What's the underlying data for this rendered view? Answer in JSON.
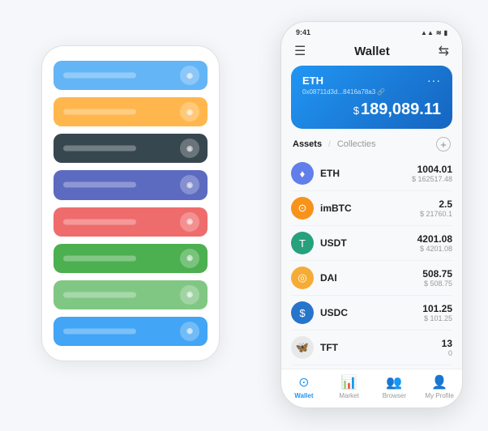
{
  "scene": {
    "bg_phone": {
      "cards": [
        {
          "color": "#64b5f6",
          "dot_label": ""
        },
        {
          "color": "#ffb74d",
          "dot_label": ""
        },
        {
          "color": "#37474f",
          "dot_label": ""
        },
        {
          "color": "#5c6bc0",
          "dot_label": ""
        },
        {
          "color": "#ef6c6c",
          "dot_label": ""
        },
        {
          "color": "#4caf50",
          "dot_label": ""
        },
        {
          "color": "#81c784",
          "dot_label": ""
        },
        {
          "color": "#42a5f5",
          "dot_label": ""
        }
      ]
    },
    "main_phone": {
      "status_bar": {
        "time": "9:41",
        "icons": "▲ ▲ 🔋"
      },
      "top_bar": {
        "title": "Wallet",
        "hamburger": "☰",
        "scan": "⇆"
      },
      "eth_card": {
        "label": "ETH",
        "address": "0x08711d3d...8416a78a3 🔗",
        "dots": "···",
        "balance_symbol": "$",
        "balance": "189,089.11"
      },
      "assets": {
        "tab_active": "Assets",
        "divider": "/",
        "tab_inactive": "Collecties",
        "add_icon": "+"
      },
      "tokens": [
        {
          "name": "ETH",
          "icon": "♦",
          "icon_bg": "#627eea",
          "icon_color": "#fff",
          "amount": "1004.01",
          "usd": "$ 162517.48"
        },
        {
          "name": "imBTC",
          "icon": "⊙",
          "icon_bg": "#f7931a",
          "icon_color": "#fff",
          "amount": "2.5",
          "usd": "$ 21760.1"
        },
        {
          "name": "USDT",
          "icon": "T",
          "icon_bg": "#26a17b",
          "icon_color": "#fff",
          "amount": "4201.08",
          "usd": "$ 4201.08"
        },
        {
          "name": "DAI",
          "icon": "◎",
          "icon_bg": "#f5ac37",
          "icon_color": "#fff",
          "amount": "508.75",
          "usd": "$ 508.75"
        },
        {
          "name": "USDC",
          "icon": "$",
          "icon_bg": "#2775ca",
          "icon_color": "#fff",
          "amount": "101.25",
          "usd": "$ 101.25"
        },
        {
          "name": "TFT",
          "icon": "🦋",
          "icon_bg": "#e8e8e8",
          "icon_color": "#333",
          "amount": "13",
          "usd": "0"
        }
      ],
      "bottom_nav": [
        {
          "label": "Wallet",
          "icon": "⊙",
          "active": true
        },
        {
          "label": "Market",
          "icon": "📊",
          "active": false
        },
        {
          "label": "Browser",
          "icon": "👥",
          "active": false
        },
        {
          "label": "My Profile",
          "icon": "👤",
          "active": false
        }
      ]
    }
  }
}
